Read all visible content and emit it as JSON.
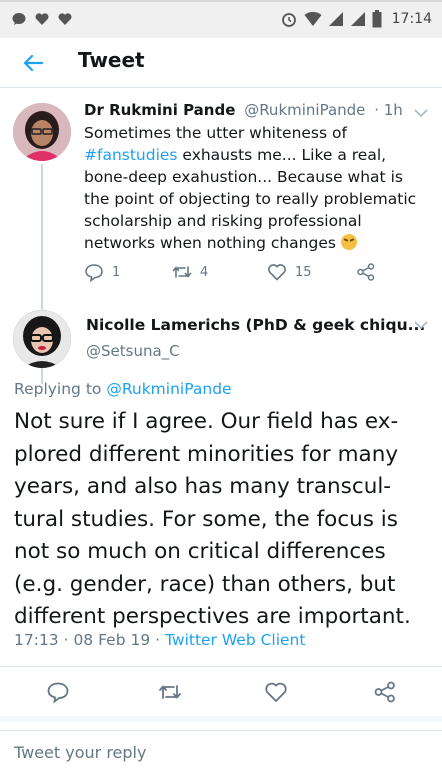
{
  "status_bar": {
    "time": "17:14",
    "left_icons": [
      "chat-bubble-icon",
      "heart-icon",
      "heart-icon"
    ],
    "right_icons": [
      "alarm-icon",
      "wifi-icon",
      "signal-icon",
      "signal-icon",
      "battery-icon"
    ]
  },
  "header": {
    "title": "Tweet",
    "back_icon": "back-arrow-icon"
  },
  "parent_tweet": {
    "name": "Dr Rukmini Pande",
    "handle": "@RukminiPande",
    "age": "· 1h",
    "text_parts": {
      "before": "Sometimes the utter whiteness of ",
      "hashtag": "#fanstudies",
      "after": " exhausts me... Like a real, bone-deep exahustion... Because what is the point of objecting to really problematic scholarship and risking professional networks when nothing changes "
    },
    "reply_count": "1",
    "retweet_count": "4",
    "like_count": "15"
  },
  "main_tweet": {
    "name": "Nicolle Lamerichs (PhD & geek chiqu...",
    "handle": "@Setsuna_C",
    "replying_to_label": "Replying to ",
    "replying_to_handle": "@RukminiPande",
    "text": "Not sure if I agree. Our field has ex-plored different minorities for many years, and also has many transcul-tural studies. For some, the focus is not so much on critical differences (e.g. gender, race) than others, but different perspectives are important.",
    "timestamp": "17:13 · 08 Feb 19 · ",
    "client": "Twitter Web Client"
  },
  "reply_bar": {
    "placeholder": "Tweet your reply"
  },
  "colors": {
    "accent": "#1da1f2",
    "secondary_text": "#657786",
    "divider": "#e1e8ed"
  }
}
